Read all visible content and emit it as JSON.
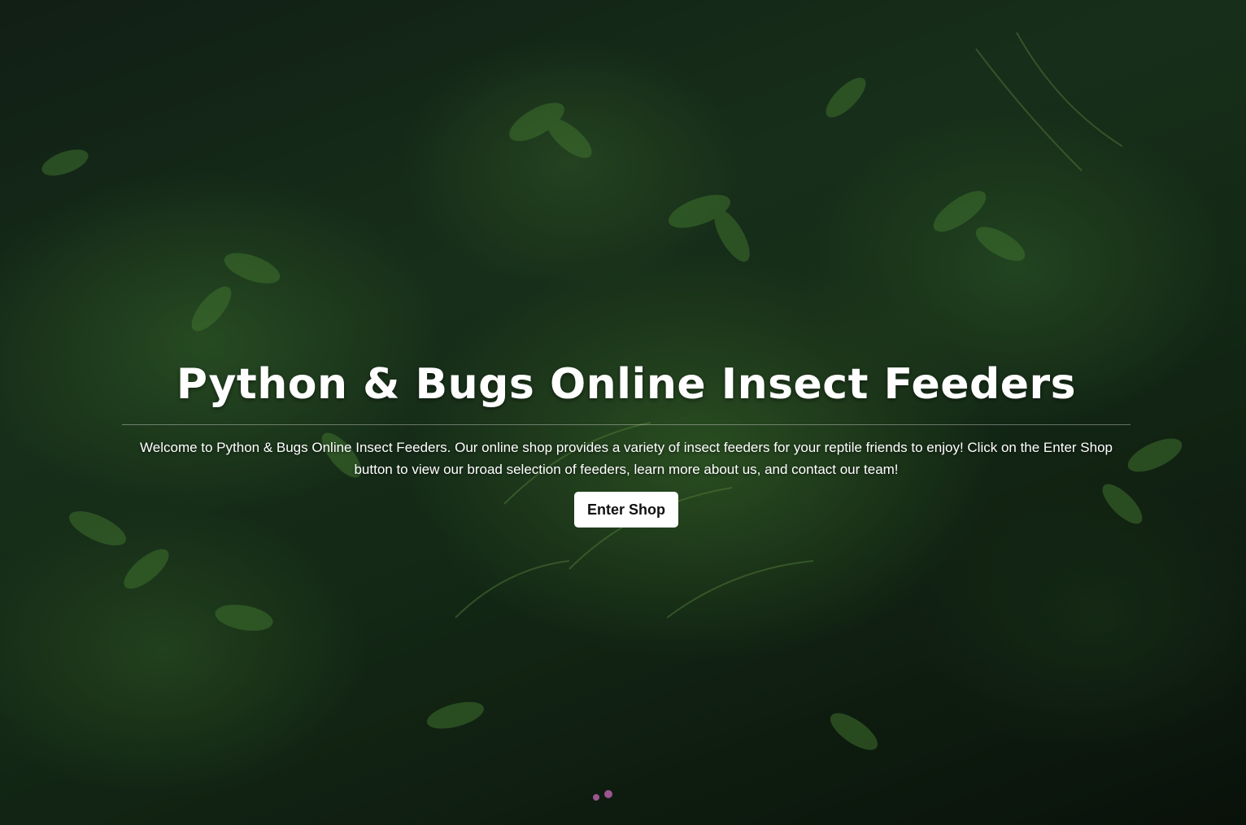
{
  "hero": {
    "title": "Python & Bugs Online Insect Feeders",
    "description": "Welcome to Python & Bugs Online Insect Feeders. Our online shop provides a variety of insect feeders for your reptile friends to enjoy! Click on the Enter Shop button to view our broad selection of feeders, learn more about us, and contact our team!",
    "button_label": "Enter Shop"
  },
  "colors": {
    "text": "#ffffff",
    "button_bg": "#ffffff",
    "button_text": "#111111",
    "foliage_dark": "#0e1a10",
    "foliage_light": "#3f7a32"
  }
}
